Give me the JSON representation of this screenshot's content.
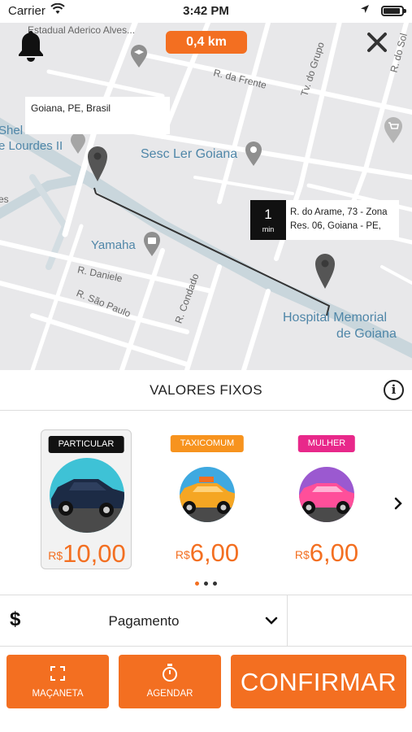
{
  "status_bar": {
    "carrier": "Carrier",
    "time": "3:42 PM"
  },
  "map": {
    "distance": "0,4 km",
    "origin_label": "Goiana, PE, Brasil",
    "destination": {
      "minutes": "1",
      "unit": "min",
      "address_line1": "R. do Arame, 73 - Zona",
      "address_line2": "Res. 06, Goiana - PE,"
    },
    "places": {
      "school": "Estadual Aderico Alves...",
      "shell": "Shel",
      "lourdes": "e Lourdes II",
      "sesc": "Sesc Ler Goiana",
      "yamaha": "Yamaha",
      "hospital_line1": "Hospital Memorial",
      "hospital_line2": "de Goiana",
      "es": "es"
    },
    "roads": {
      "da_frente": "R. da Frente",
      "grupo": "Tv. do Grupo",
      "do_sol": "R. do Sol",
      "daniele": "R. Daniele",
      "sao_paulo": "R. São Paulo",
      "condado": "R. Condado"
    }
  },
  "fixed_values": {
    "title": "VALORES FIXOS"
  },
  "vehicles": [
    {
      "tag": "PARTICULAR",
      "currency": "R$",
      "price": "10,00",
      "tag_color": "#111111",
      "selected": true
    },
    {
      "tag": "TAXICOMUM",
      "currency": "R$",
      "price": "6,00",
      "tag_color": "#f7931e",
      "selected": false
    },
    {
      "tag": "MULHER",
      "currency": "R$",
      "price": "6,00",
      "tag_color": "#e8288a",
      "selected": false
    }
  ],
  "payment": {
    "icon": "$",
    "label": "Pagamento"
  },
  "actions": {
    "handle": "MAÇANETA",
    "schedule": "AGENDAR",
    "confirm": "CONFIRMAR"
  },
  "colors": {
    "accent": "#f36f21",
    "map_bg": "#e8e8ea",
    "route": "#333333"
  }
}
